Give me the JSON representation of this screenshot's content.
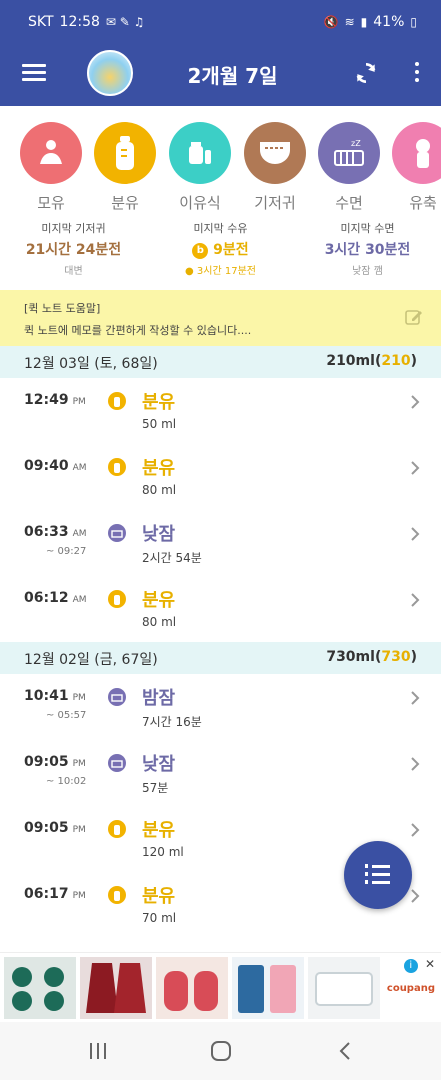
{
  "status_bar": {
    "carrier": "SKT",
    "time": "12:58",
    "battery": "41%"
  },
  "toolbar": {
    "title": "2개월 7일"
  },
  "categories": [
    {
      "label": "모유",
      "color": "#ee6f73"
    },
    {
      "label": "분유",
      "color": "#f2b300"
    },
    {
      "label": "이유식",
      "color": "#3ccfc6"
    },
    {
      "label": "기저귀",
      "color": "#b07955"
    },
    {
      "label": "수면",
      "color": "#7870b3"
    },
    {
      "label": "유축",
      "color": "#f07fb0"
    }
  ],
  "summary": [
    {
      "heading": "미지막 기저귀",
      "value": "21시간 24분전",
      "sub": "대변",
      "color": "#a4703f"
    },
    {
      "heading": "미지막 수유",
      "value": "9분전",
      "sub": "3시간 17분전",
      "color": "#e7b000"
    },
    {
      "heading": "미지막 수면",
      "value": "3시간 30분전",
      "sub": "낮잠 깸",
      "color": "#6d6aa6"
    }
  ],
  "note": {
    "title": "[퀵 노트 도움말]",
    "text": "퀵 노트에 메모를 간편하게 작성할 수 있습니다...."
  },
  "days": [
    {
      "date": "12월 03일 (토, 68일)",
      "total": "210ml",
      "total_highlight": "210",
      "entries": [
        {
          "time": "12:49",
          "ampm": "PM",
          "until": "",
          "type": "formula",
          "name": "분유",
          "detail": "50 ml"
        },
        {
          "time": "09:40",
          "ampm": "AM",
          "until": "",
          "type": "formula",
          "name": "분유",
          "detail": "80 ml"
        },
        {
          "time": "06:33",
          "ampm": "AM",
          "until": "~ 09:27",
          "type": "sleep",
          "name": "낮잠",
          "detail": "2시간 54분"
        },
        {
          "time": "06:12",
          "ampm": "AM",
          "until": "",
          "type": "formula",
          "name": "분유",
          "detail": "80 ml"
        }
      ]
    },
    {
      "date": "12월 02일 (금, 67일)",
      "total": "730ml",
      "total_highlight": "730",
      "entries": [
        {
          "time": "10:41",
          "ampm": "PM",
          "until": "~ 05:57",
          "type": "sleep",
          "name": "밤잠",
          "detail": "7시간 16분"
        },
        {
          "time": "09:05",
          "ampm": "PM",
          "until": "~ 10:02",
          "type": "sleep",
          "name": "낮잠",
          "detail": "57분"
        },
        {
          "time": "09:05",
          "ampm": "PM",
          "until": "",
          "type": "formula",
          "name": "분유",
          "detail": "120 ml"
        },
        {
          "time": "06:17",
          "ampm": "PM",
          "until": "",
          "type": "formula",
          "name": "분유",
          "detail": "70 ml"
        }
      ]
    }
  ],
  "ad": {
    "brand": "coupang"
  },
  "colors": {
    "primary": "#3a50a3",
    "formula": "#e7b000",
    "sleep": "#6d6aa6",
    "diaper": "#a4703f"
  }
}
